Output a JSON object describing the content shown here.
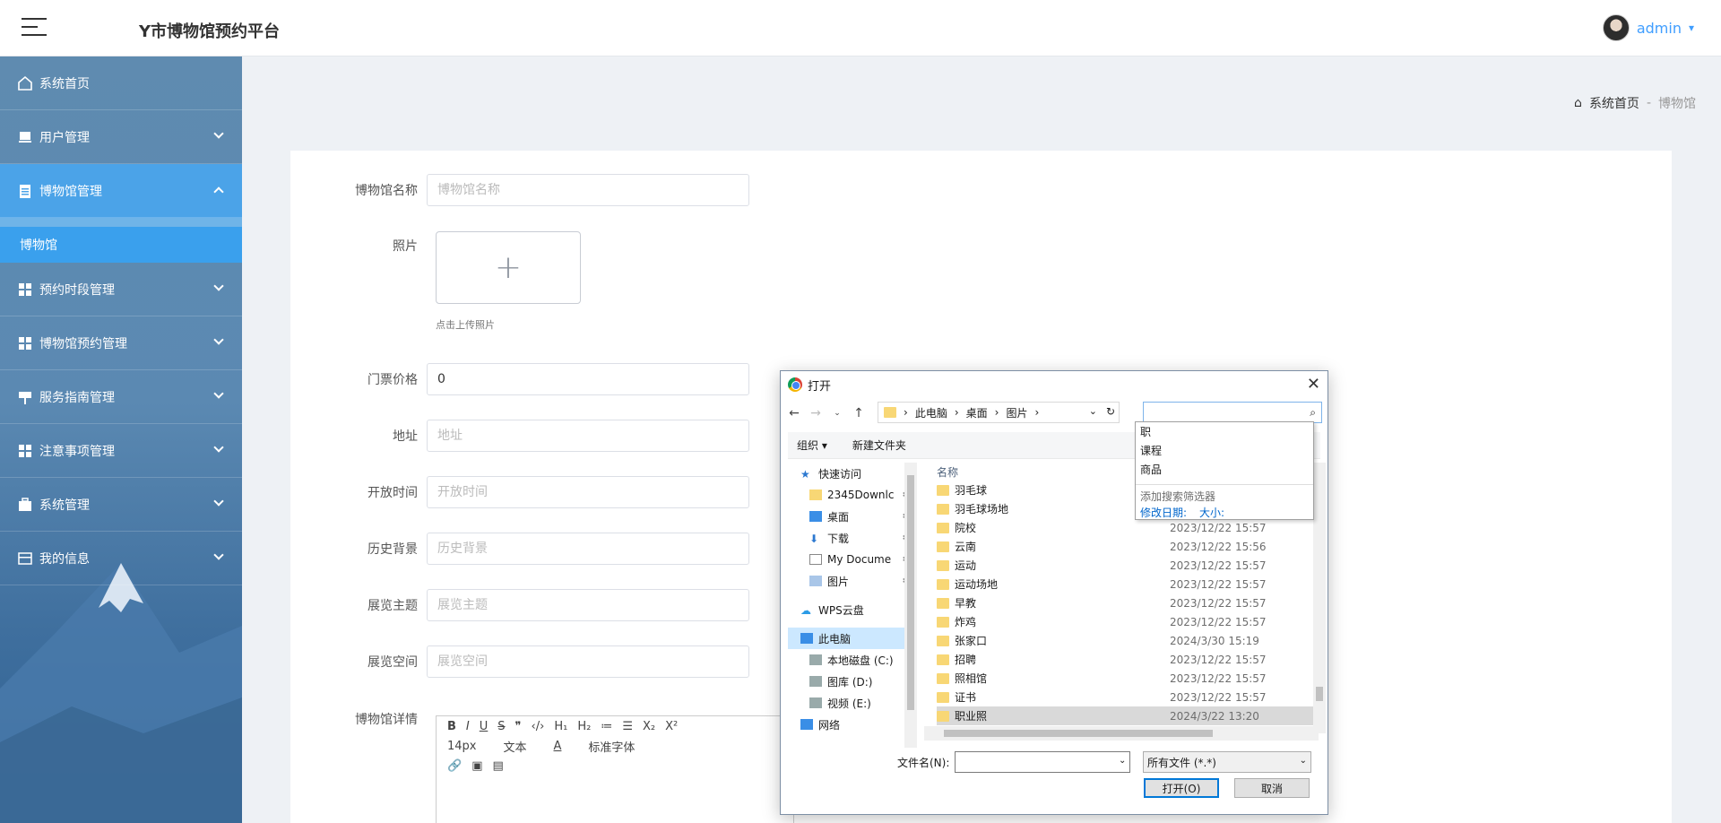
{
  "header": {
    "app_title": "Y市博物馆预约平台",
    "user_name": "admin",
    "user_caret": "▾"
  },
  "sidebar": {
    "items": [
      {
        "label": "系统首页",
        "icon": "home-icon"
      },
      {
        "label": "用户管理",
        "icon": "user-icon"
      },
      {
        "label": "博物馆管理",
        "icon": "clipboard-icon"
      },
      {
        "label": "预约时段管理",
        "icon": "grid-icon"
      },
      {
        "label": "博物馆预约管理",
        "icon": "grid-icon"
      },
      {
        "label": "服务指南管理",
        "icon": "sign-icon"
      },
      {
        "label": "注意事项管理",
        "icon": "grid-icon"
      },
      {
        "label": "系统管理",
        "icon": "briefcase-icon"
      },
      {
        "label": "我的信息",
        "icon": "card-icon"
      }
    ],
    "sub_item": "博物馆"
  },
  "breadcrumb": {
    "home": "系统首页",
    "sep": "-",
    "current": "博物馆"
  },
  "form": {
    "name_label": "博物馆名称",
    "name_placeholder": "博物馆名称",
    "photo_label": "照片",
    "upload_plus": "+",
    "upload_tip": "点击上传照片",
    "price_label": "门票价格",
    "price_value": "0",
    "address_label": "地址",
    "address_placeholder": "地址",
    "open_label": "开放时间",
    "open_placeholder": "开放时间",
    "history_label": "历史背景",
    "history_placeholder": "历史背景",
    "theme_label": "展览主题",
    "theme_placeholder": "展览主题",
    "space_label": "展览空间",
    "space_placeholder": "展览空间",
    "detail_label": "博物馆详情"
  },
  "editor": {
    "row1": [
      "B",
      "I",
      "U",
      "S",
      "❞",
      "‹/›",
      "H₁",
      "H₂",
      "≔",
      "☰",
      "X₂",
      "X²"
    ],
    "font_size": "14px",
    "text_type": "文本",
    "font_family": "标准字体",
    "row3": [
      "🔗",
      "▣",
      "▤"
    ]
  },
  "dialog": {
    "title": "打开",
    "close": "✕",
    "path": [
      "此电脑",
      "桌面",
      "图片"
    ],
    "toolbar": {
      "organize": "组织 ▾",
      "new_folder": "新建文件夹"
    },
    "nav": [
      {
        "label": "快速访问",
        "icon": "star-icon",
        "pin": false,
        "indent": 1
      },
      {
        "label": "2345Downlc",
        "icon": "folder-icon",
        "pin": true,
        "indent": 2
      },
      {
        "label": "桌面",
        "icon": "desktop-icon",
        "pin": true,
        "indent": 2
      },
      {
        "label": "下载",
        "icon": "download-icon",
        "pin": true,
        "indent": 2
      },
      {
        "label": "My Docume",
        "icon": "document-icon",
        "pin": true,
        "indent": 2
      },
      {
        "label": "图片",
        "icon": "picture-icon",
        "pin": true,
        "indent": 2
      },
      {
        "label": "WPS云盘",
        "icon": "cloud-icon",
        "pin": false,
        "indent": 1
      },
      {
        "label": "此电脑",
        "icon": "computer-icon",
        "pin": false,
        "indent": 1,
        "selected": true
      },
      {
        "label": "本地磁盘 (C:)",
        "icon": "drive-icon",
        "pin": false,
        "indent": 2
      },
      {
        "label": "图库 (D:)",
        "icon": "drive-icon",
        "pin": false,
        "indent": 2
      },
      {
        "label": "视频 (E:)",
        "icon": "drive-icon",
        "pin": false,
        "indent": 2
      },
      {
        "label": "网络",
        "icon": "network-icon",
        "pin": false,
        "indent": 1
      }
    ],
    "column_name": "名称",
    "files": [
      {
        "name": "羽毛球",
        "date": ""
      },
      {
        "name": "羽毛球场地",
        "date": ""
      },
      {
        "name": "院校",
        "date": "2023/12/22 15:57"
      },
      {
        "name": "云南",
        "date": "2023/12/22 15:56"
      },
      {
        "name": "运动",
        "date": "2023/12/22 15:57"
      },
      {
        "name": "运动场地",
        "date": "2023/12/22 15:57"
      },
      {
        "name": "早教",
        "date": "2023/12/22 15:57"
      },
      {
        "name": "炸鸡",
        "date": "2023/12/22 15:57"
      },
      {
        "name": "张家口",
        "date": "2024/3/30 15:19"
      },
      {
        "name": "招聘",
        "date": "2023/12/22 15:57"
      },
      {
        "name": "照相馆",
        "date": "2023/12/22 15:57"
      },
      {
        "name": "证书",
        "date": "2023/12/22 15:57"
      },
      {
        "name": "职业照",
        "date": "2024/3/22 13:20",
        "selected": true
      }
    ],
    "suggestions": [
      "职",
      "课程",
      "商品"
    ],
    "add_filter": "添加搜索筛选器",
    "filter_links": [
      "修改日期:",
      "大小:"
    ],
    "filename_label": "文件名(N):",
    "filename_value": "",
    "filetype": "所有文件 (*.*)",
    "open_btn": "打开(O)",
    "cancel_btn": "取消"
  },
  "colors": {
    "sidebar_active": "#4ba3e8",
    "accent": "#409eff",
    "dialog_border": "#7d8fa5"
  }
}
